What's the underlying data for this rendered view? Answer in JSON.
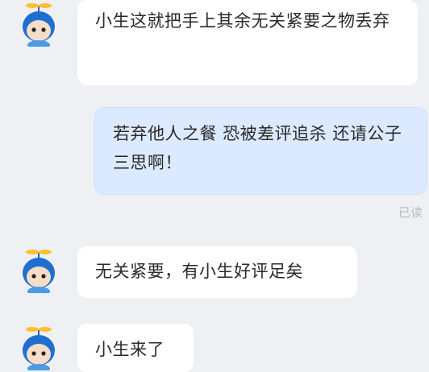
{
  "chat": {
    "messages": [
      {
        "sender": "other",
        "text": "小生这就把手上其余无关紧要之物丢弃"
      },
      {
        "sender": "me",
        "text": "若弃他人之餐 恐被差评追杀 还请公子三思啊！"
      },
      {
        "sender": "other",
        "text": "无关紧要，有小生好评足矣"
      },
      {
        "sender": "other",
        "text": "小生来了"
      }
    ],
    "read_status": "已读"
  },
  "colors": {
    "background": "#eef0f4",
    "incoming_bubble": "#ffffff",
    "outgoing_bubble": "#dceaff",
    "avatar_hair": "#1f6fd0",
    "avatar_body": "#4a9be8"
  },
  "icons": {
    "avatar": "propeller-hat-mascot-avatar"
  }
}
